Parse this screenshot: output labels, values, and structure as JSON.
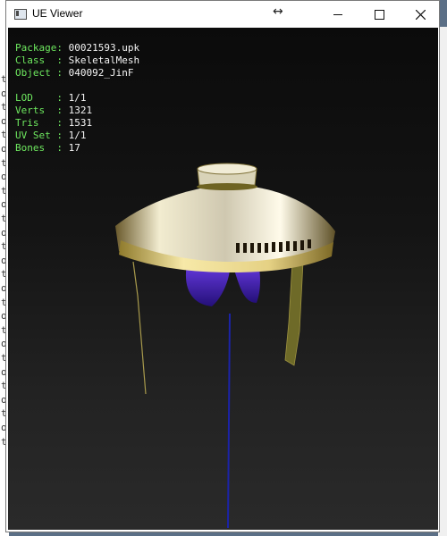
{
  "window": {
    "title": "UE Viewer"
  },
  "info": {
    "package": {
      "key": "Package",
      "sep": ": ",
      "value": "00021593.upk"
    },
    "class": {
      "key": "Class  ",
      "sep": ": ",
      "value": "SkeletalMesh"
    },
    "object": {
      "key": "Object ",
      "sep": ": ",
      "value": "040092_JinF"
    },
    "lod": {
      "key": "LOD    ",
      "sep": ": ",
      "value": "1/1"
    },
    "verts": {
      "key": "Verts  ",
      "sep": ": ",
      "value": "1321"
    },
    "tris": {
      "key": "Tris   ",
      "sep": ": ",
      "value": "1531"
    },
    "uvset": {
      "key": "UV Set ",
      "sep": ": ",
      "value": "1/1"
    },
    "bones": {
      "key": "Bones  ",
      "sep": ": ",
      "value": "17"
    }
  },
  "colors": {
    "label": "#6ee85f",
    "value": "#f4f4f4",
    "viewport_bg": "#141414",
    "gold": "#c9a227",
    "purple": "#5a2ed0"
  },
  "icons": {
    "app": "window-icon",
    "resize": "resize-arrows-icon",
    "minimize": "minimize-icon",
    "maximize": "maximize-icon",
    "close": "close-icon"
  },
  "background_fragments": [
    "t",
    "o",
    "t",
    "o",
    "t",
    "o",
    "t",
    "o",
    "t",
    "o",
    "t",
    "o",
    "t",
    "o",
    "t",
    "o",
    "t",
    "o",
    "t",
    "o",
    "t",
    "o",
    "t",
    "o",
    "t",
    "o",
    "t"
  ]
}
